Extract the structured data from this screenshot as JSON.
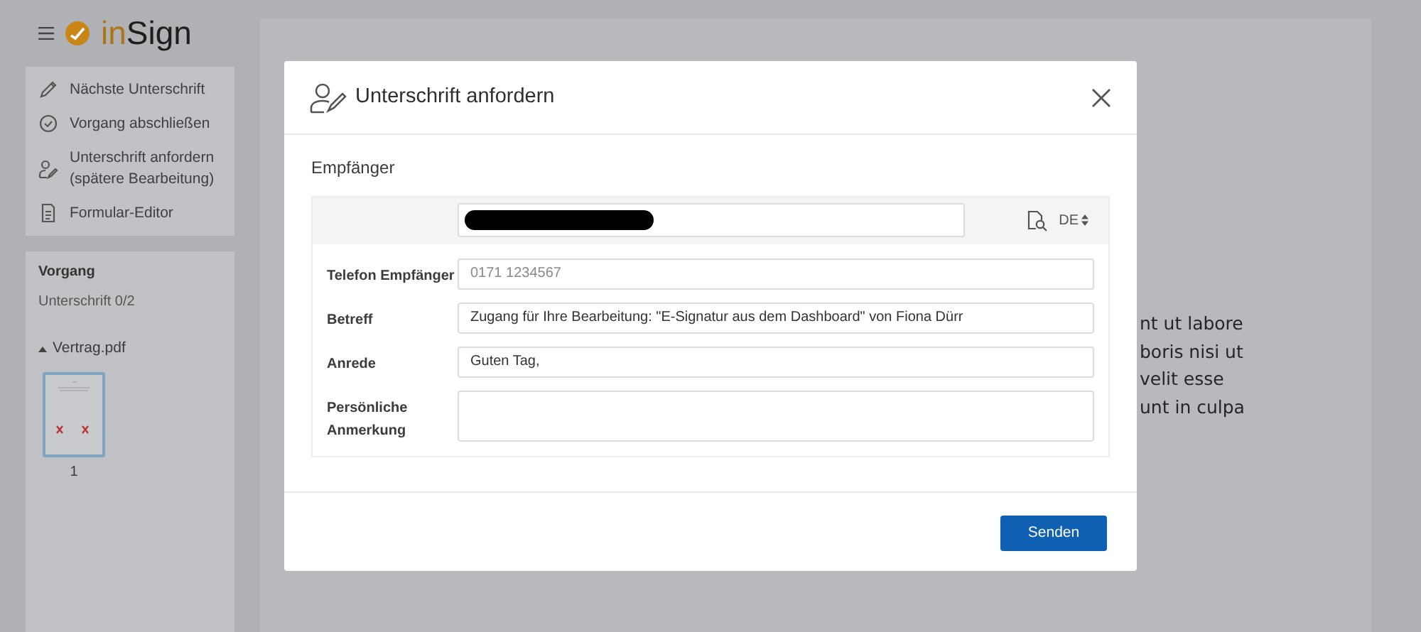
{
  "app": {
    "logo_accent": "in",
    "logo_text": "Sign"
  },
  "actions": [
    {
      "kind": "pen",
      "label": "Nächste Unterschrift"
    },
    {
      "kind": "check",
      "label": "Vorgang abschließen"
    },
    {
      "kind": "user-pen",
      "label": "Unterschrift anfordern\n(spätere Bearbeitung)"
    },
    {
      "kind": "form",
      "label": "Formular-Editor"
    }
  ],
  "process": {
    "title": "Vorgang",
    "status": "Unterschrift 0/2",
    "file": {
      "name": "Vertrag.pdf",
      "expanded": true
    },
    "pages": [
      {
        "number": "1",
        "selected": true
      }
    ]
  },
  "document": {
    "lines": [
      "nt ut labore",
      "boris nisi ut",
      "velit esse",
      "unt in culpa"
    ]
  },
  "dialog": {
    "title": "Unterschrift anfordern",
    "section": "Empfänger",
    "language": "DE",
    "fields": [
      {
        "kind": "input",
        "label": "Telefon Empfänger",
        "placeholder": "0171 1234567"
      },
      {
        "kind": "input",
        "label": "Betreff",
        "value": "Zugang für Ihre Bearbeitung: \"E-Signatur aus dem Dashboard\" von Fiona Dürr"
      },
      {
        "kind": "input",
        "label": "Anrede",
        "value": "Guten Tag,"
      },
      {
        "kind": "textarea",
        "label": "Persönliche Anmerkung"
      }
    ],
    "submit": "Senden"
  }
}
